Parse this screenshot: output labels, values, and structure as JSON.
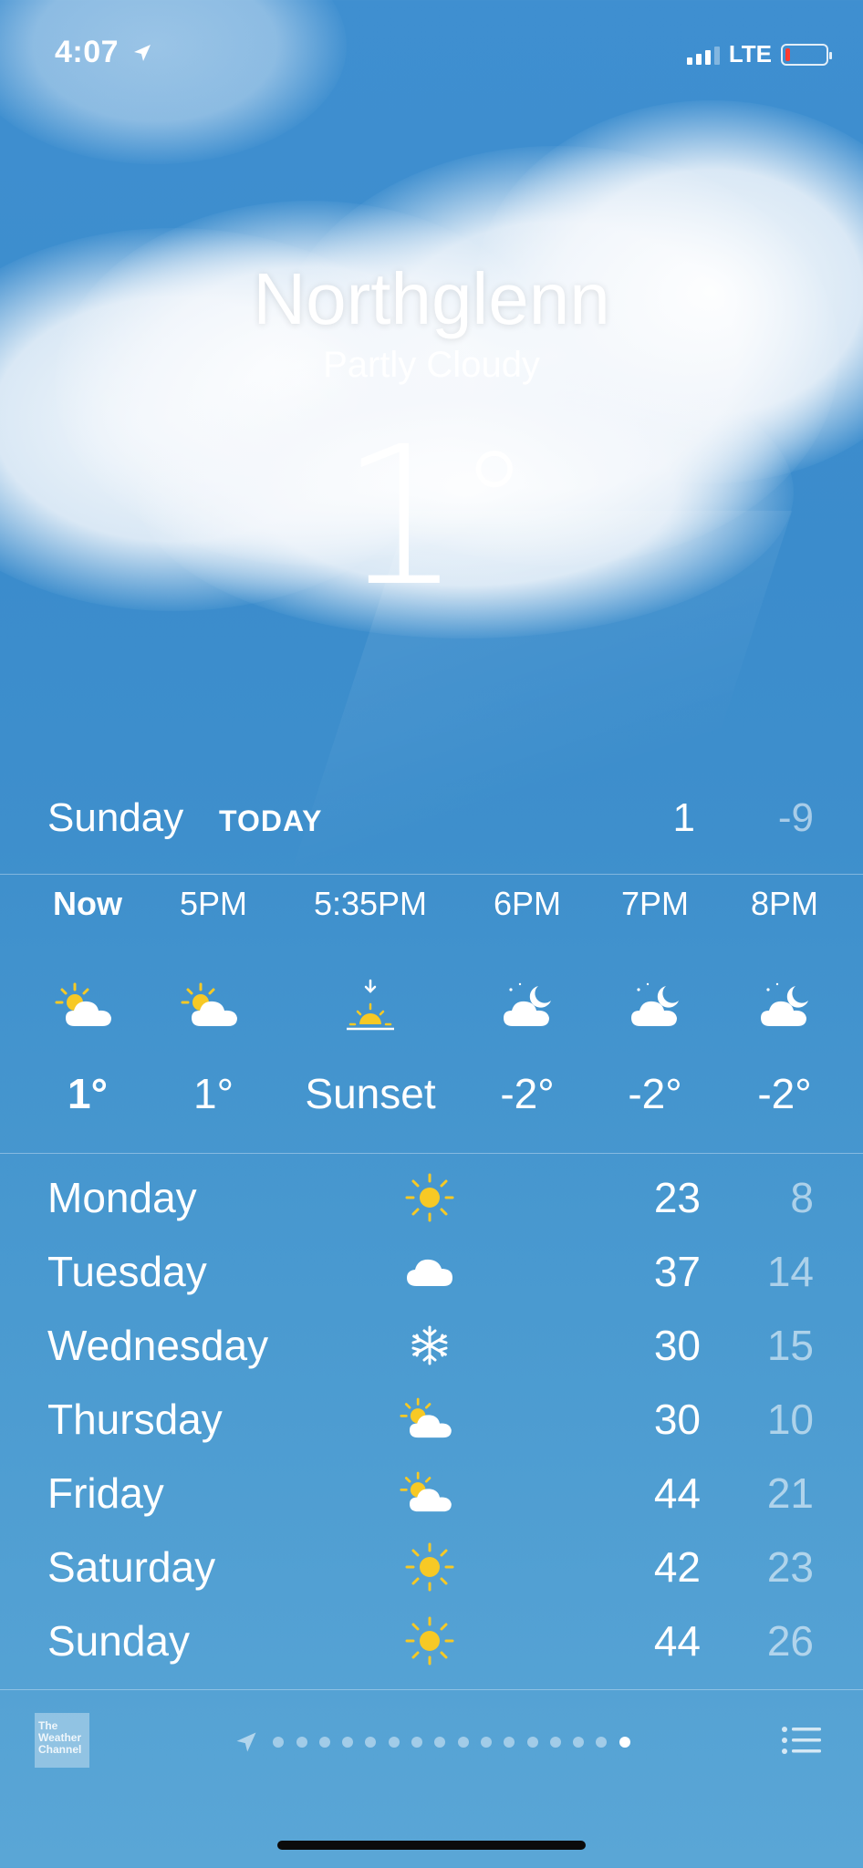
{
  "status_bar": {
    "time": "4:07",
    "network": "LTE",
    "location_icon": "location-arrow-icon"
  },
  "header": {
    "city": "Northglenn",
    "condition": "Partly Cloudy",
    "temperature": "1",
    "degree": "°"
  },
  "today": {
    "day": "Sunday",
    "label": "TODAY",
    "high": "1",
    "low": "-9"
  },
  "hourly": [
    {
      "time": "Now",
      "icon": "partly-sunny-icon",
      "temp": "1°"
    },
    {
      "time": "5PM",
      "icon": "partly-sunny-icon",
      "temp": "1°"
    },
    {
      "time": "5:35PM",
      "icon": "sunset-icon",
      "temp": "Sunset"
    },
    {
      "time": "6PM",
      "icon": "partly-cloudy-night-icon",
      "temp": "-2°"
    },
    {
      "time": "7PM",
      "icon": "partly-cloudy-night-icon",
      "temp": "-2°"
    },
    {
      "time": "8PM",
      "icon": "partly-cloudy-night-icon",
      "temp": "-2°"
    }
  ],
  "daily": [
    {
      "day": "Monday",
      "icon": "sun-icon",
      "high": "23",
      "low": "8"
    },
    {
      "day": "Tuesday",
      "icon": "cloud-icon",
      "high": "37",
      "low": "14"
    },
    {
      "day": "Wednesday",
      "icon": "snowflake-icon",
      "high": "30",
      "low": "15"
    },
    {
      "day": "Thursday",
      "icon": "partly-sunny-icon",
      "high": "30",
      "low": "10"
    },
    {
      "day": "Friday",
      "icon": "partly-sunny-icon",
      "high": "44",
      "low": "21"
    },
    {
      "day": "Saturday",
      "icon": "sun-icon",
      "high": "42",
      "low": "23"
    },
    {
      "day": "Sunday",
      "icon": "sun-icon",
      "high": "44",
      "low": "26"
    }
  ],
  "footer": {
    "logo_text": [
      "The",
      "Weather",
      "Channel"
    ],
    "page_count": 16,
    "active_page": 16
  },
  "colors": {
    "sun": "#f7c925",
    "background": "#3f8fd0",
    "battery_low": "#ff3b30"
  }
}
